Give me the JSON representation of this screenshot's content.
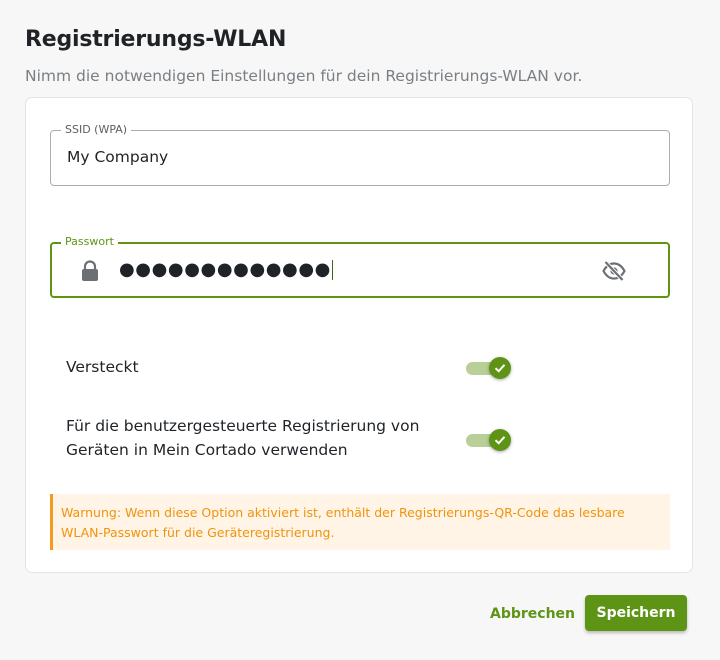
{
  "dialog": {
    "title": "Registrierungs-WLAN",
    "subtitle": "Nimm die notwendigen Einstellungen für dein Registrierungs-WLAN vor."
  },
  "ssid_field": {
    "label": "SSID (WPA)",
    "value": "My Company"
  },
  "password_field": {
    "label": "Passwort",
    "masked_value": "●●●●●●●●●●●●●",
    "icons": {
      "leading": "lock-icon",
      "trailing": "eye-off-icon"
    }
  },
  "toggles": {
    "hidden": {
      "label": "Versteckt",
      "checked": true
    },
    "self_registration": {
      "label_line1": "Für die benutzergesteuerte Registrierung von",
      "label_line2": "Geräten in Mein Cortado verwenden",
      "checked": true
    }
  },
  "warning": {
    "text": "Warnung: Wenn diese Option aktiviert ist, enthält der Registrierungs-QR-Code das lesbare WLAN-Passwort für die Geräteregistrierung."
  },
  "actions": {
    "cancel_label": "Abbrechen",
    "save_label": "Speichern"
  },
  "colors": {
    "accent": "#5e9416",
    "warning_text": "#f0930f",
    "warning_bg": "#fff4e5"
  }
}
